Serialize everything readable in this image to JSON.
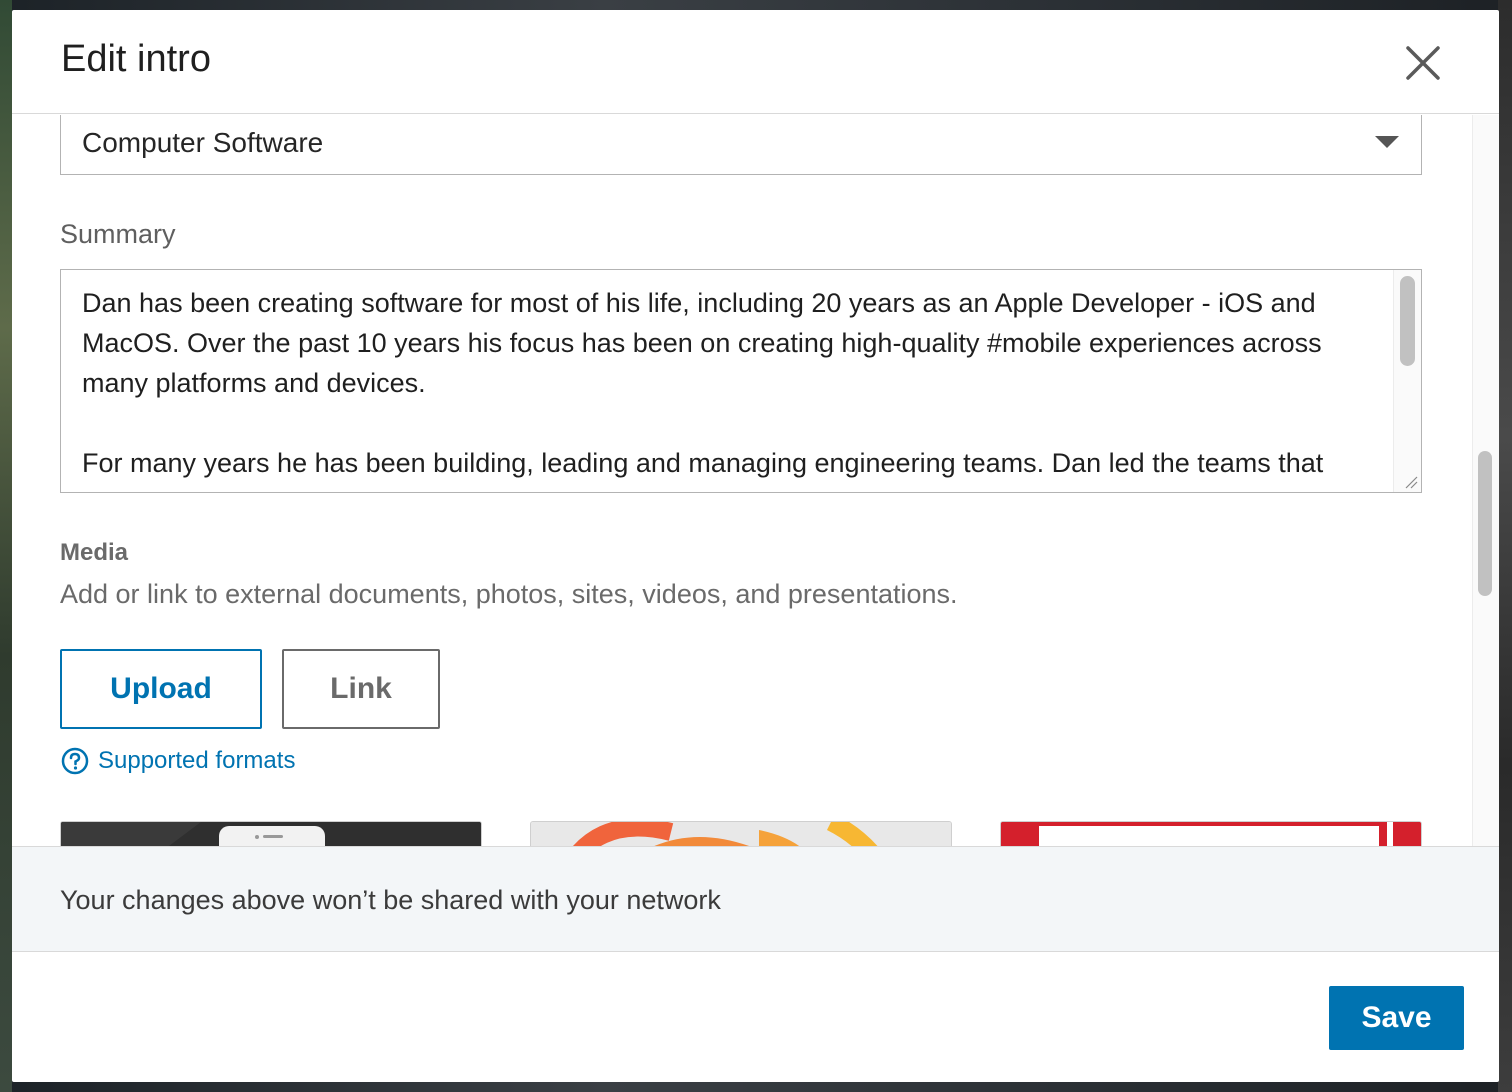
{
  "dialog": {
    "title": "Edit intro",
    "close_icon": "close-icon"
  },
  "industry": {
    "value": "Computer Software",
    "icon": "chevron-down-icon"
  },
  "summary": {
    "label": "Summary",
    "text": "Dan has been creating software for most of his life, including 20 years as an Apple Developer - iOS and MacOS. Over the past 10 years his focus has been on creating high-quality #mobile experiences across many platforms and devices.\n\nFor many years he has been building, leading and managing engineering teams. Dan led the teams that"
  },
  "media": {
    "heading": "Media",
    "description": "Add or link to external documents, photos, sites, videos, and presentations.",
    "upload_label": "Upload",
    "link_label": "Link",
    "supported_formats_label": "Supported formats",
    "help_icon": "help-circle-icon"
  },
  "notice": {
    "text": "Your changes above won’t be shared with your network"
  },
  "footer": {
    "save_label": "Save"
  },
  "colors": {
    "accent": "#0073b1",
    "notice_bg": "#f3f6f8"
  }
}
